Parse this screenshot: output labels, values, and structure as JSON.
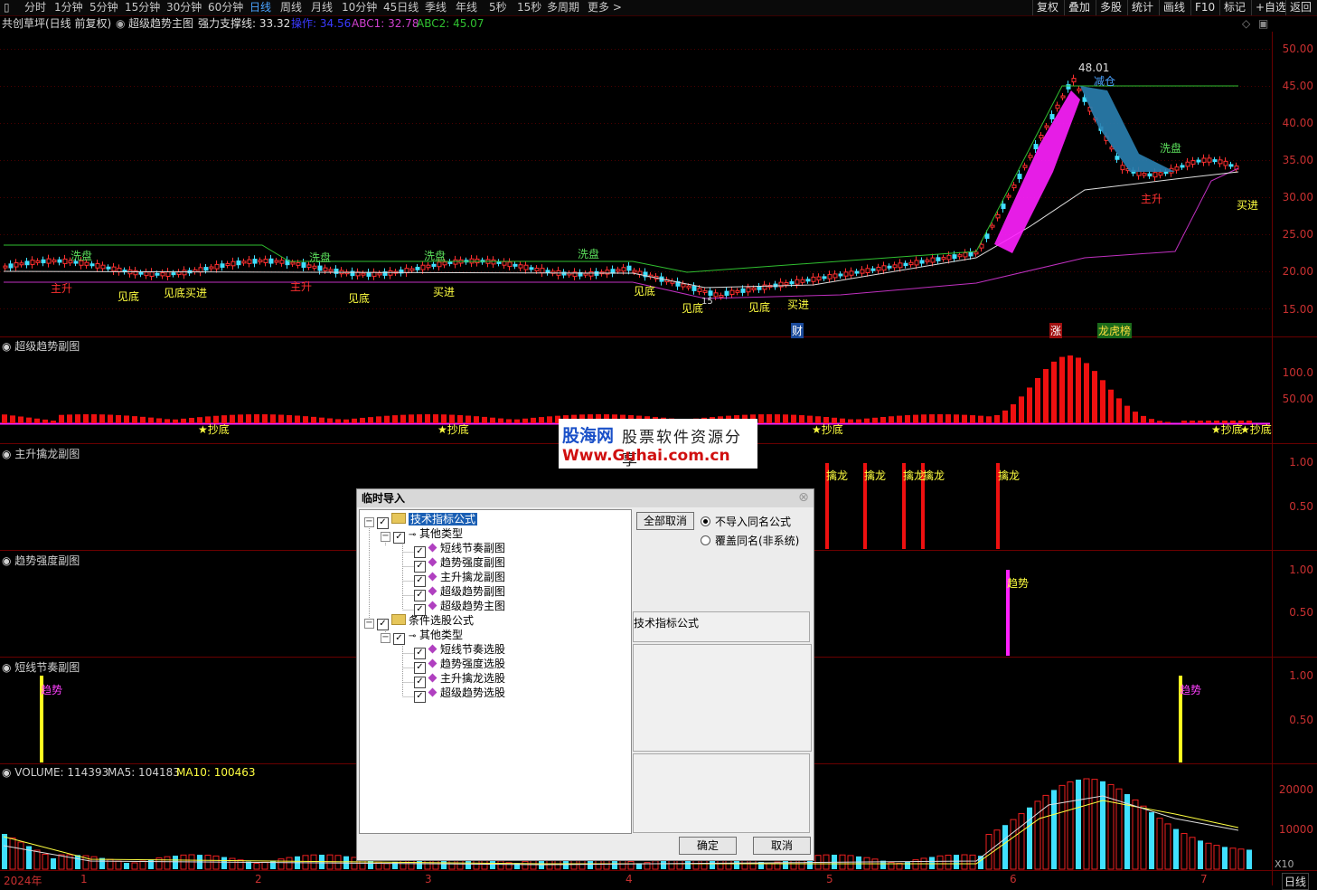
{
  "topbar": {
    "periods": [
      "分时",
      "1分钟",
      "5分钟",
      "15分钟",
      "30分钟",
      "60分钟",
      "日线",
      "周线",
      "月线",
      "10分钟",
      "45日线",
      "季线",
      "年线",
      "5秒",
      "15秒",
      "多周期",
      "更多 >"
    ],
    "active_period": "日线",
    "right_buttons": [
      "复权",
      "叠加",
      "多股",
      "统计",
      "画线",
      "F10",
      "标记",
      "+自选",
      "返回"
    ]
  },
  "info": {
    "stock": "共创草坪(日线 前复权)",
    "indicator": "超级趋势主图",
    "support": "强力支撑线: 33.32",
    "op": "操作: 34.56",
    "abc1": "ABC1: 32.78",
    "abc2": "ABC2: 45.07"
  },
  "colors": {
    "op": "#3030ff",
    "abc1": "#d040d0",
    "abc2": "#30c030",
    "axis": "#c83030",
    "grid": "#5a0000"
  },
  "main_pane": {
    "price_axis": [
      "50.00",
      "45.00",
      "40.00",
      "35.00",
      "30.00",
      "25.00",
      "20.00",
      "15.00"
    ],
    "high_label": "48.01",
    "signals": {
      "xipan": "洗盘",
      "zhusheng": "主升",
      "jiandi": "见底",
      "jiandi_maijin": "见底买进",
      "maijin": "买进",
      "jiancang": "减仓",
      "low_label": "15",
      "cai": "财",
      "zhang": "涨",
      "longhu": "龙虎榜"
    }
  },
  "pane2": {
    "title": "超级趋势副图",
    "axis": [
      "100.0",
      "50.00"
    ],
    "signal": "★抄底"
  },
  "pane3": {
    "title": "主升擒龙副图",
    "axis": [
      "1.00",
      "0.50"
    ],
    "signal": "擒龙"
  },
  "pane4": {
    "title": "趋势强度副图",
    "axis": [
      "1.00",
      "0.50"
    ],
    "signal": "趋势"
  },
  "pane5": {
    "title": "短线节奏副图",
    "axis": [
      "1.00",
      "0.50"
    ],
    "signal": "趋势"
  },
  "volume_pane": {
    "vol": "VOLUME: 114393",
    "ma5": "MA5: 104183",
    "ma10": "MA10: 100463",
    "axis": [
      "20000",
      "10000"
    ],
    "unit": "X10"
  },
  "x_axis": {
    "year": "2024年",
    "months": [
      "1",
      "2",
      "3",
      "4",
      "5",
      "6",
      "7"
    ],
    "period_tab": "日线"
  },
  "watermark": {
    "brand": "股海网",
    "slogan": "股票软件资源分享",
    "url": "Www.Guhai.com.cn"
  },
  "dialog": {
    "title": "临时导入",
    "tree": {
      "root1": "技术指标公式",
      "group1": "其他类型",
      "items1": [
        "短线节奏副图",
        "趋势强度副图",
        "主升擒龙副图",
        "超级趋势副图",
        "超级趋势主图"
      ],
      "root2": "条件选股公式",
      "group2": "其他类型",
      "items2": [
        "短线节奏选股",
        "趋势强度选股",
        "主升擒龙选股",
        "超级趋势选股"
      ]
    },
    "deselect_all": "全部取消",
    "radio_skip": "不导入同名公式",
    "radio_overwrite": "覆盖同名(非系统)",
    "category_label": "技术指标公式",
    "ok": "确定",
    "cancel": "取消"
  }
}
